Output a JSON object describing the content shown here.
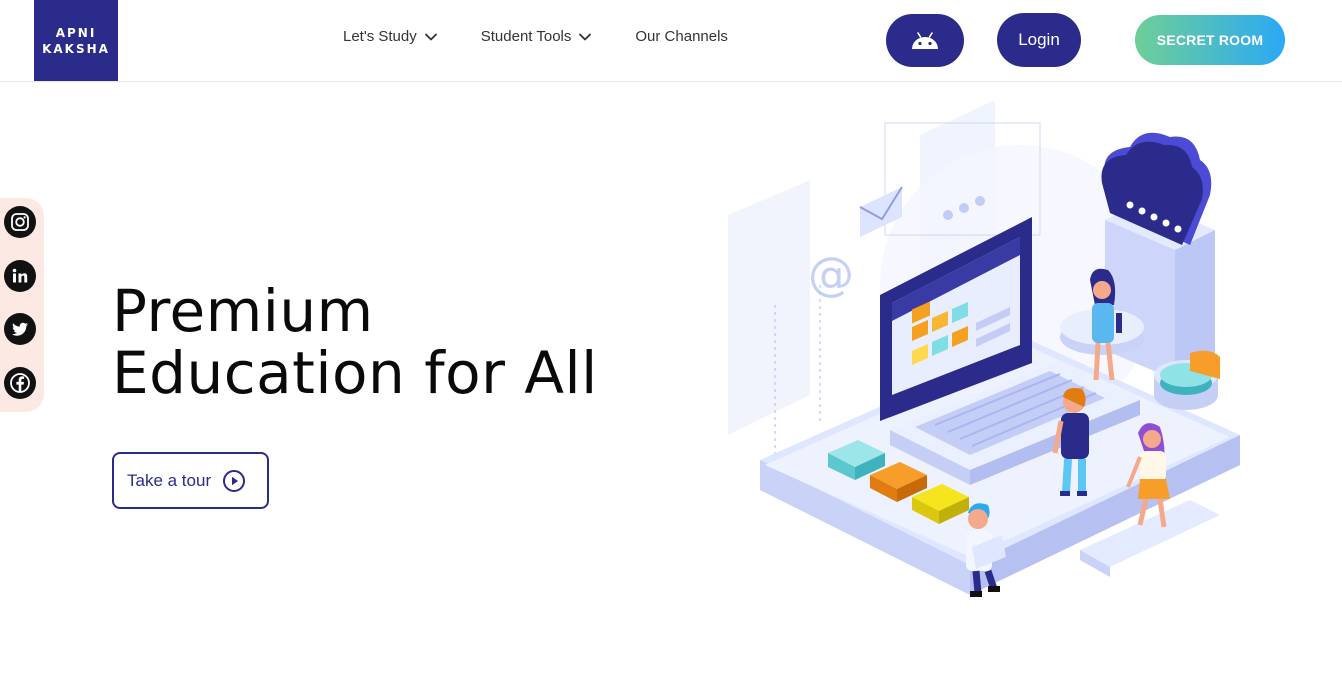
{
  "header": {
    "logo_line1": "APNI",
    "logo_line2": "KAKSHA",
    "nav": [
      {
        "label": "Let's Study",
        "has_dropdown": true
      },
      {
        "label": "Student Tools",
        "has_dropdown": true
      },
      {
        "label": "Our Channels",
        "has_dropdown": false
      }
    ],
    "android_icon": "android-icon",
    "login_label": "Login",
    "secret_label": "SECRET ROOM"
  },
  "social": [
    "instagram-icon",
    "linkedin-icon",
    "twitter-icon",
    "facebook-icon"
  ],
  "hero": {
    "title_line1": "Premium",
    "title_line2": "Education for All",
    "tour_label": "Take a tour"
  },
  "colors": {
    "brand": "#2b2b8c",
    "secret_gradient_start": "#6fcf97",
    "secret_gradient_end": "#2aa9f5",
    "social_bg": "#fde9e4"
  }
}
